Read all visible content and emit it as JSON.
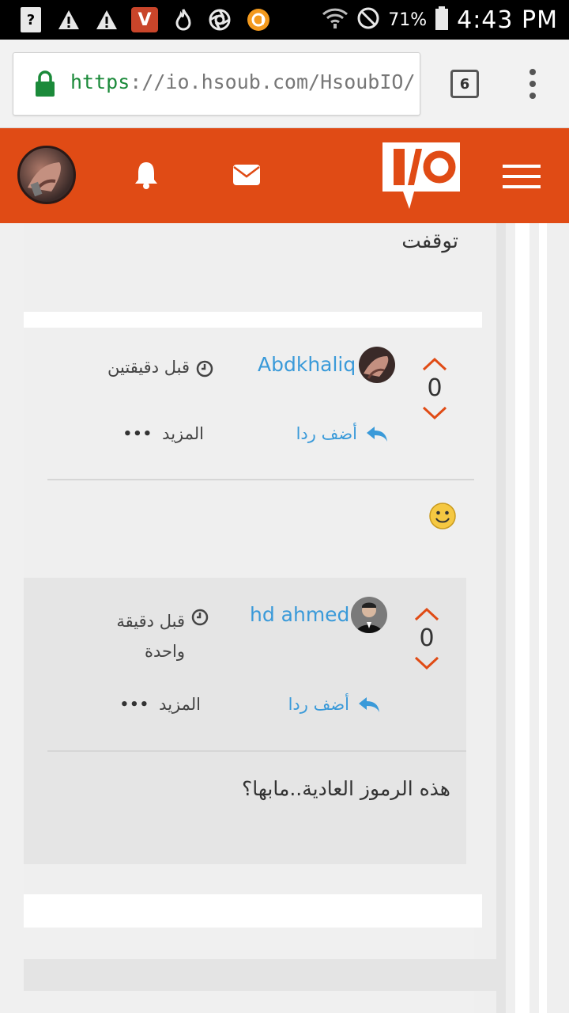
{
  "status_bar": {
    "battery_percent": "71%",
    "time": "4:43 PM",
    "icons": [
      "help-icon",
      "warning-icon",
      "warning-icon",
      "video-app-icon",
      "flame-icon",
      "aperture-icon",
      "app-circle-icon",
      "wifi-icon",
      "do-not-disturb-icon",
      "battery-icon"
    ]
  },
  "browser": {
    "url_scheme": "https",
    "url_rest": "://io.hsoub.com/HsoubIO/!",
    "tab_count": "6"
  },
  "site_header": {
    "accent_color": "#e04b15",
    "icons": [
      "avatar",
      "bell-icon",
      "envelope-icon",
      "io-logo",
      "hamburger-menu-icon"
    ]
  },
  "previous_comment": {
    "text": "توقفت"
  },
  "comments": [
    {
      "author": "Abdkhaliq",
      "time": "قبل دقيقتين",
      "votes": "0",
      "reply_label": "أضف ردا",
      "more_label": "المزيد",
      "more_dots": "•••",
      "body_emoji": "🙂"
    },
    {
      "author": "hd ahmed",
      "time_line1": "قبل دقيقة",
      "time_line2": "واحدة",
      "votes": "0",
      "reply_label": "أضف ردا",
      "more_label": "المزيد",
      "more_dots": "•••",
      "body": "هذه الرموز العادية..مابها؟"
    }
  ]
}
